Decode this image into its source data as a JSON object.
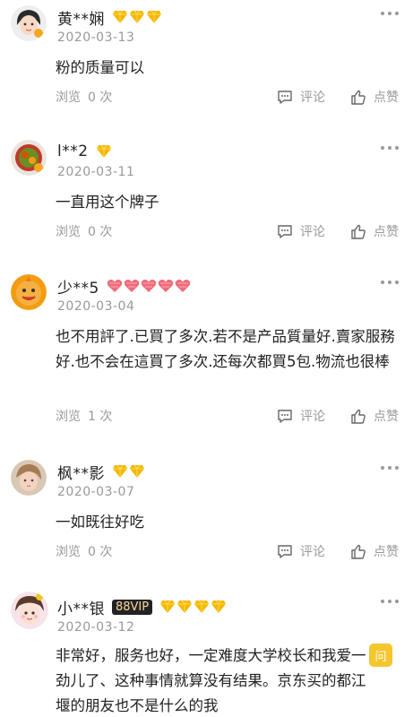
{
  "reviews": [
    {
      "username": "黄**娴",
      "badge_count": 3,
      "badge_type": "gold-diamond",
      "date": "2020-03-13",
      "content": "粉的质量可以",
      "views_label": "浏览",
      "views_count": "0",
      "views_unit": "次",
      "comment_label": "评论",
      "like_label": "点赞"
    },
    {
      "username": "l**2",
      "badge_count": 1,
      "badge_type": "gold-diamond",
      "date": "2020-03-11",
      "content": "一直用这个牌子",
      "views_label": "浏览",
      "views_count": "0",
      "views_unit": "次",
      "comment_label": "评论",
      "like_label": "点赞"
    },
    {
      "username": "少**5",
      "badge_count": 5,
      "badge_type": "red-heart",
      "date": "2020-03-04",
      "content": "也不用評了.已買了多次.若不是产品質量好.賣家服務好.也不会在這買了多次.还每次都買5包.物流也很棒",
      "views_label": "浏览",
      "views_count": "1",
      "views_unit": "次",
      "comment_label": "评论",
      "like_label": "点赞"
    },
    {
      "username": "枫**影",
      "badge_count": 2,
      "badge_type": "gold-diamond",
      "date": "2020-03-07",
      "content": "一如既往好吃",
      "views_label": "浏览",
      "views_count": "0",
      "views_unit": "次",
      "comment_label": "评论",
      "like_label": "点赞"
    },
    {
      "username": "小**银",
      "vip_badge": "88VIP",
      "badge_count": 4,
      "badge_type": "gold-diamond",
      "date": "2020-03-12",
      "content": "非常好，服务也好，一定难度大学校长和我爱一劲儿了、这种事情就算没有结果。京东买的都江堰的朋友也不是什么的我"
    }
  ],
  "floating": {
    "ask_label": "问"
  },
  "colors": {
    "gold": "#f5b800",
    "heart": "#f06b7a",
    "muted": "#999999",
    "ask_bg": "#f6c62f"
  }
}
